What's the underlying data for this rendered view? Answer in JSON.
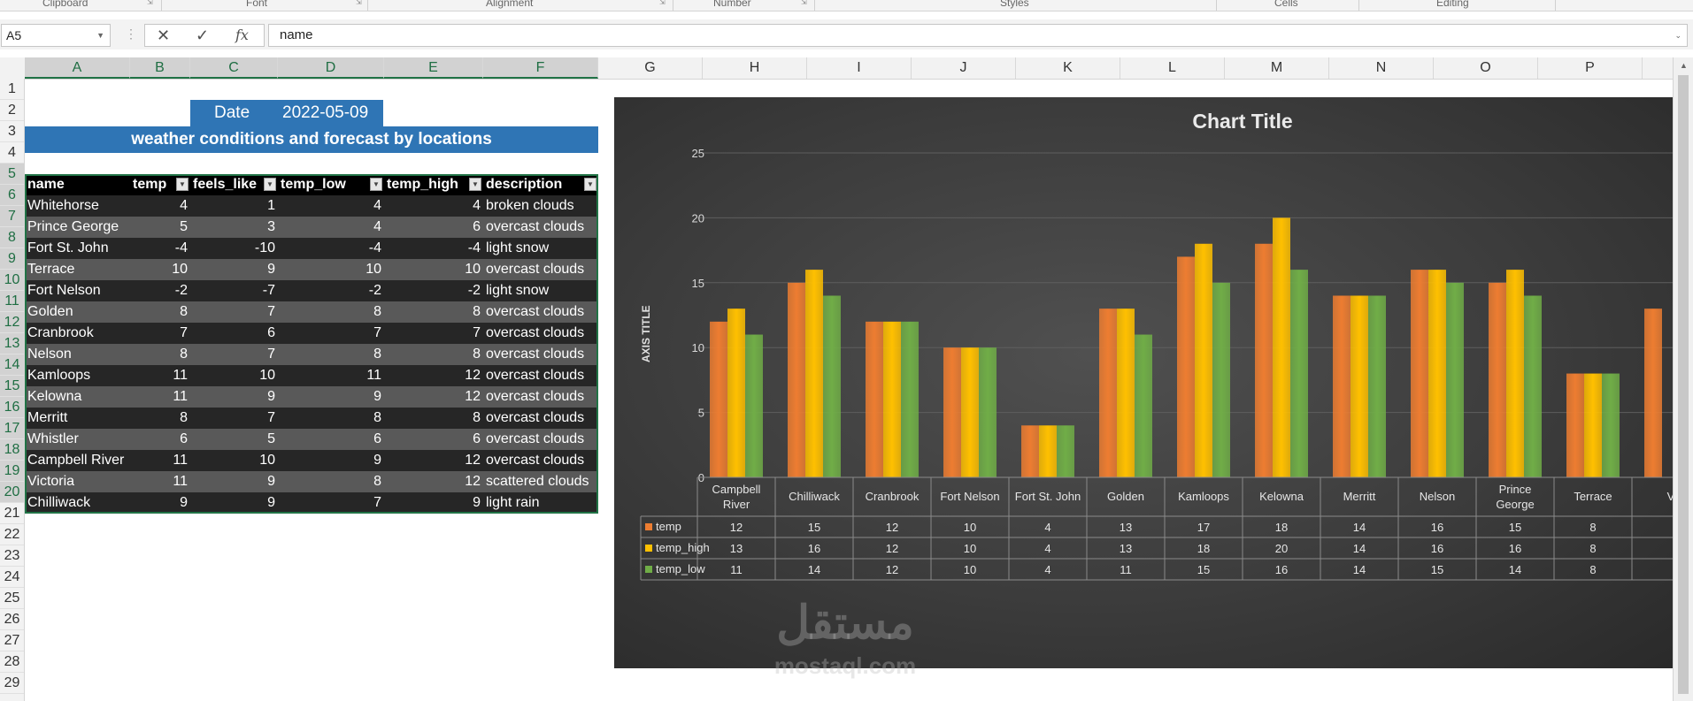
{
  "ribbon": {
    "groups": [
      "Clipboard",
      "Font",
      "Alignment",
      "Number",
      "Styles",
      "Cells",
      "Editing"
    ]
  },
  "formula_bar": {
    "name_box": "A5",
    "cancel_icon": "close-icon",
    "enter_icon": "check-icon",
    "fx_label": "fx",
    "value": "name"
  },
  "columns": [
    "A",
    "B",
    "C",
    "D",
    "E",
    "F",
    "G",
    "H",
    "I",
    "J",
    "K",
    "L",
    "M",
    "N",
    "O",
    "P"
  ],
  "rows": [
    "1",
    "2",
    "3",
    "4",
    "5",
    "6",
    "7",
    "8",
    "9",
    "10",
    "11",
    "12",
    "13",
    "14",
    "15",
    "16",
    "17",
    "18",
    "19",
    "20",
    "21",
    "22",
    "23",
    "24",
    "25",
    "26",
    "27",
    "28",
    "29"
  ],
  "sheet": {
    "date_label": "Date",
    "date_value": "2022-05-09",
    "banner": "weather conditions and forecast by locations",
    "table": {
      "headers": [
        "name",
        "temp",
        "feels_like",
        "temp_low",
        "temp_high",
        "description"
      ],
      "rows": [
        [
          "Whitehorse",
          "4",
          "1",
          "4",
          "4",
          "broken clouds"
        ],
        [
          "Prince George",
          "5",
          "3",
          "4",
          "6",
          "overcast clouds"
        ],
        [
          "Fort St. John",
          "-4",
          "-10",
          "-4",
          "-4",
          "light snow"
        ],
        [
          "Terrace",
          "10",
          "9",
          "10",
          "10",
          "overcast clouds"
        ],
        [
          "Fort Nelson",
          "-2",
          "-7",
          "-2",
          "-2",
          "light snow"
        ],
        [
          "Golden",
          "8",
          "7",
          "8",
          "8",
          "overcast clouds"
        ],
        [
          "Cranbrook",
          "7",
          "6",
          "7",
          "7",
          "overcast clouds"
        ],
        [
          "Nelson",
          "8",
          "7",
          "8",
          "8",
          "overcast clouds"
        ],
        [
          "Kamloops",
          "11",
          "10",
          "11",
          "12",
          "overcast clouds"
        ],
        [
          "Kelowna",
          "11",
          "9",
          "9",
          "12",
          "overcast clouds"
        ],
        [
          "Merritt",
          "8",
          "7",
          "8",
          "8",
          "overcast clouds"
        ],
        [
          "Whistler",
          "6",
          "5",
          "6",
          "6",
          "overcast clouds"
        ],
        [
          "Campbell River",
          "11",
          "10",
          "9",
          "12",
          "overcast clouds"
        ],
        [
          "Victoria",
          "11",
          "9",
          "8",
          "12",
          "scattered clouds"
        ],
        [
          "Chilliwack",
          "9",
          "9",
          "7",
          "9",
          "light rain"
        ]
      ]
    }
  },
  "chart_data": {
    "type": "bar",
    "title": "Chart Title",
    "ylabel": "AXIS TITLE",
    "ylim": [
      0,
      25
    ],
    "yticks": [
      0,
      5,
      10,
      15,
      20,
      25
    ],
    "grid": true,
    "categories": [
      [
        "Campbell",
        "River"
      ],
      [
        "Chilliwack"
      ],
      [
        "Cranbrook"
      ],
      [
        "Fort Nelson"
      ],
      [
        "Fort St. John"
      ],
      [
        "Golden"
      ],
      [
        "Kamloops"
      ],
      [
        "Kelowna"
      ],
      [
        "Merritt"
      ],
      [
        "Nelson"
      ],
      [
        "Prince",
        "George"
      ],
      [
        "Terrace"
      ],
      [
        "V"
      ]
    ],
    "series": [
      {
        "name": "temp",
        "color": "#ed7d31",
        "values": [
          12,
          15,
          12,
          10,
          4,
          13,
          17,
          18,
          14,
          16,
          15,
          8,
          13
        ]
      },
      {
        "name": "temp_high",
        "color": "#ffc000",
        "values": [
          13,
          16,
          12,
          10,
          4,
          13,
          18,
          20,
          14,
          16,
          16,
          8,
          null
        ]
      },
      {
        "name": "temp_low",
        "color": "#70ad47",
        "values": [
          11,
          14,
          12,
          10,
          4,
          11,
          15,
          16,
          14,
          15,
          14,
          8,
          null
        ]
      }
    ],
    "data_table_values": [
      [
        "12",
        "15",
        "12",
        "10",
        "4",
        "13",
        "17",
        "18",
        "14",
        "16",
        "15",
        "8",
        ""
      ],
      [
        "13",
        "16",
        "12",
        "10",
        "4",
        "13",
        "18",
        "20",
        "14",
        "16",
        "16",
        "8",
        ""
      ],
      [
        "11",
        "14",
        "12",
        "10",
        "4",
        "11",
        "15",
        "16",
        "14",
        "15",
        "14",
        "8",
        ""
      ]
    ]
  },
  "watermark": {
    "arabic": "مستقل",
    "latin": "mostaql.com"
  }
}
